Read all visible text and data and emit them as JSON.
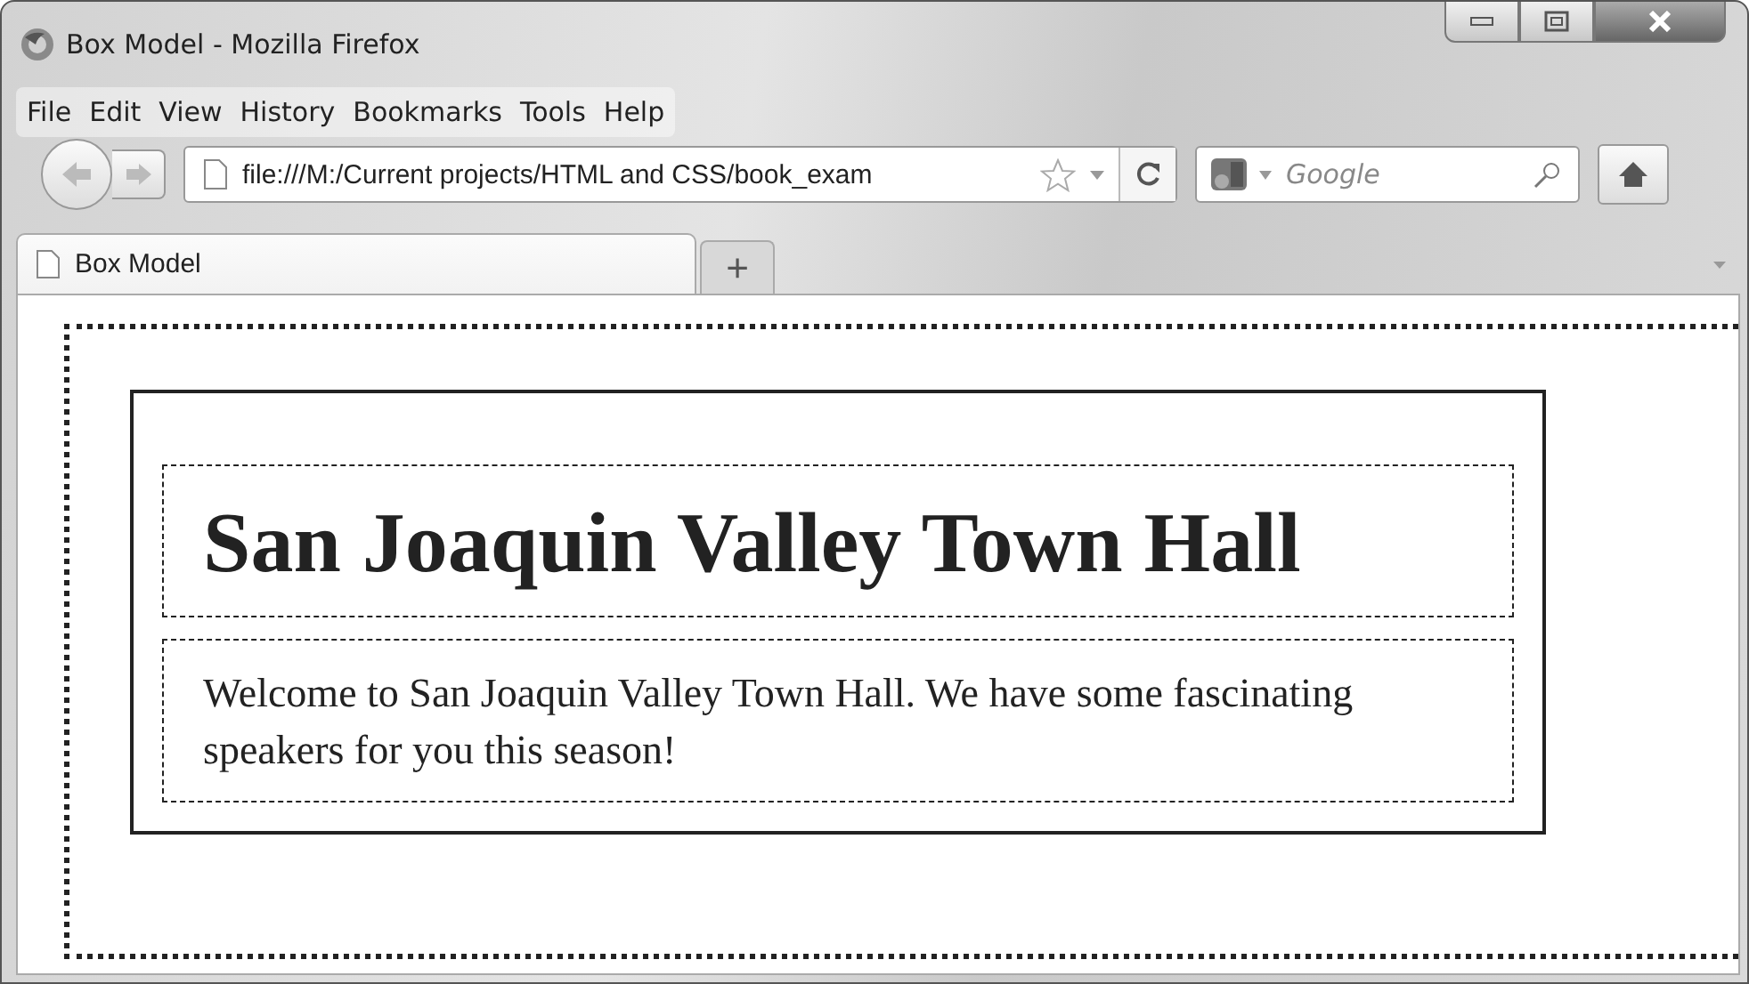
{
  "window": {
    "title": "Box Model - Mozilla Firefox"
  },
  "menu": [
    "File",
    "Edit",
    "View",
    "History",
    "Bookmarks",
    "Tools",
    "Help"
  ],
  "address_bar": {
    "value": "file:///M:/Current projects/HTML and CSS/book_exam"
  },
  "search": {
    "placeholder": "Google"
  },
  "tabs": [
    {
      "label": "Box Model",
      "selected": true
    }
  ],
  "new_tab": "+",
  "page": {
    "heading": "San Joaquin Valley Town Hall",
    "paragraph": "Welcome to San Joaquin Valley Town Hall. We have some fascinating speakers for you this season!"
  }
}
